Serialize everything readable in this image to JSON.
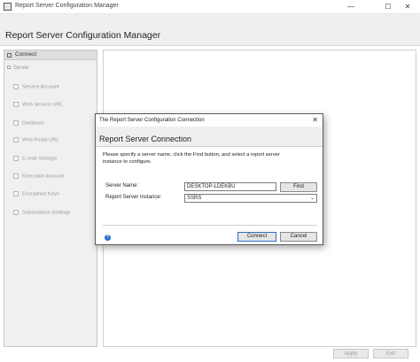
{
  "window": {
    "title": "Report Server Configuration Manager",
    "minimize": "—",
    "maximize": "☐",
    "close": "✕"
  },
  "header": {
    "title": "Report Server Configuration Manager"
  },
  "sidebar": {
    "connect_label": "Connect",
    "server_label": "Server",
    "items": [
      {
        "label": "Service Account"
      },
      {
        "label": "Web Service URL"
      },
      {
        "label": "Database"
      },
      {
        "label": "Web Portal URL"
      },
      {
        "label": "E-mail Settings"
      },
      {
        "label": "Execution Account"
      },
      {
        "label": "Encryption Keys"
      },
      {
        "label": "Subscription Settings"
      }
    ]
  },
  "footer": {
    "apply_label": "Apply",
    "exit_label": "Exit"
  },
  "dialog": {
    "title": "The Report Server Configuration Connection",
    "close": "✕",
    "header": "Report Server Connection",
    "description": "Please specify a server name, click the Find button, and select a report server instance to configure.",
    "server_name_label": "Server Name:",
    "server_name_value": "DESKTOP-LDEKBU",
    "find_label": "Find",
    "instance_label": "Report Server Instance:",
    "instance_value": "SSRS",
    "help": "?",
    "connect_label": "Connect",
    "cancel_label": "Cancel"
  }
}
